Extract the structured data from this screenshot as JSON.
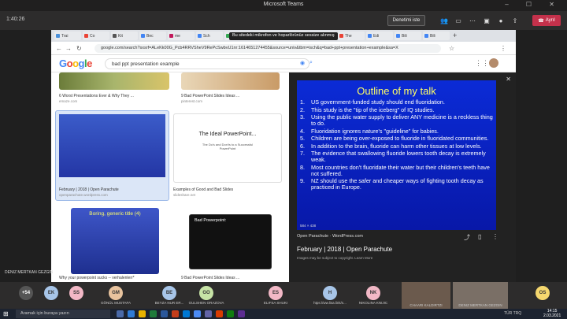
{
  "teams": {
    "title": "Microsoft Teams",
    "call_time": "1:40:26",
    "control_button": "Denetimi iste",
    "leave_button": "Ayrıl"
  },
  "browser": {
    "tooltip": "Bu sitedeki mikrofon ve hoparlörünüz sessize alınmış",
    "tabs": [
      {
        "label": "Trai",
        "color": "#4a90d9"
      },
      {
        "label": "Co",
        "color": "#ea4335"
      },
      {
        "label": "Kit",
        "color": "#555"
      },
      {
        "label": "Bec",
        "color": "#4285f4"
      },
      {
        "label": "me",
        "color": "#c2185b"
      },
      {
        "label": "Sch",
        "color": "#4285f4"
      },
      {
        "label": "Hal",
        "color": "#34a853"
      },
      {
        "label": "IEC",
        "color": "#777"
      },
      {
        "label": "Edi",
        "color": "#4285f4"
      },
      {
        "label": "Edi",
        "color": "#4285f4"
      },
      {
        "label": "The",
        "color": "#ea4335"
      },
      {
        "label": "Edi",
        "color": "#4285f4"
      },
      {
        "label": "Bili",
        "color": "#4285f4"
      },
      {
        "label": "Bili",
        "color": "#4285f4"
      }
    ],
    "url": "google.com/search?sxsrf=ALeKk00G_Pcb4RRVSheV9RePcSwbvU1nr:1614651274455&source=univ&tbm=isch&q=bad+ppt+presentation+example&sa=X"
  },
  "google": {
    "logo": "Google",
    "query": "bad ppt presentation example",
    "results": [
      {
        "caption": "6 Worst Presentations Ever & Why They ...",
        "source": "emaze.com"
      },
      {
        "caption": "9 Bad PowerPoint Slides Ideas ...",
        "source": "pinterest.com"
      },
      {
        "caption": "February | 2018 | Open Parachute",
        "source": "openparachute.wordpress.com"
      },
      {
        "caption": "Examples of Good and Bad Slides",
        "source": "slideshare.net"
      },
      {
        "caption": "Why your powerpoint sucks -- verhalenlerr*",
        "source": ""
      },
      {
        "caption": "9 Bad PowerPoint Slides Ideas ...",
        "source": ""
      }
    ],
    "thumb_texts": {
      "good_bad": "The Ideal PowerPoint...",
      "good_bad_sub": "The Do's and Don'ts to a Successful PowerPoint",
      "boring": "Boring, generic title (4)",
      "bad_ppt": "Bad Powerpoint:"
    }
  },
  "viewer": {
    "slide_title": "Outline of my talk",
    "items": [
      {
        "n": "1.",
        "text": "US government-funded study should end fluoridation."
      },
      {
        "n": "2.",
        "text": "This study is the \"tip of the iceberg\" of IQ studies."
      },
      {
        "n": "3.",
        "text": "Using the public water supply to deliver ANY medicine is a reckless thing to do."
      },
      {
        "n": "4.",
        "text": "Fluoridation ignores nature's \"guideline\" for babies."
      },
      {
        "n": "5.",
        "text": "Children are being over-exposed to fluoride in fluoridated communities."
      },
      {
        "n": "6.",
        "text": "In addition to the brain, fluoride can harm other tissues at low levels."
      },
      {
        "n": "7.",
        "text": "The evidence that swallowing fluoride lowers tooth decay is extremely weak."
      },
      {
        "n": "8.",
        "text": "Most countries don't fluoridate their water but their children's teeth have not suffered."
      },
      {
        "n": "9.",
        "text": "NZ should use the safer and cheaper ways of fighting tooth decay as practiced in Europe."
      }
    ],
    "image_size": "584 × 438",
    "source": "Open Parachute · WordPress.com",
    "title": "February | 2018 | Open Parachute",
    "note": "Images may be subject to copyright. Learn More"
  },
  "participants": {
    "sharer": "DENIZ MERTKAN GEZGIN",
    "more": "+54",
    "people": [
      {
        "initials": "EK",
        "name": "",
        "color": "#a7c5e8"
      },
      {
        "initials": "SS",
        "name": "",
        "color": "#f2b8c6"
      },
      {
        "initials": "GM",
        "name": "GÖNÜL MUSTAFA",
        "color": "#e8c39e"
      },
      {
        "initials": "BE",
        "name": "BEYZA NUR ER...",
        "color": "#a7c5e8"
      },
      {
        "initials": "GO",
        "name": "GULSHEN ORAZOVA",
        "color": "#c7e3a6"
      },
      {
        "initials": "ES",
        "name": "ELIFSA SHUKI",
        "color": "#f2b8c6"
      },
      {
        "initials": "H",
        "name": "htps://ww.lisa.link/s...",
        "color": "#a7c5e8"
      },
      {
        "initials": "NK",
        "name": "NIKOLINA KNIJIC",
        "color": "#f2b8c6"
      },
      {
        "initials": "OS",
        "name": "",
        "color": "#f5d76e"
      }
    ],
    "video1": "CHAARI KALDIRTZI",
    "video2": "DENIZ MERTKAN GEZGIN"
  },
  "taskbar": {
    "search": "Aramak için buraya yazın",
    "lang": "TÜR TRQ",
    "time": "14:15",
    "date": "2.03.2021"
  }
}
